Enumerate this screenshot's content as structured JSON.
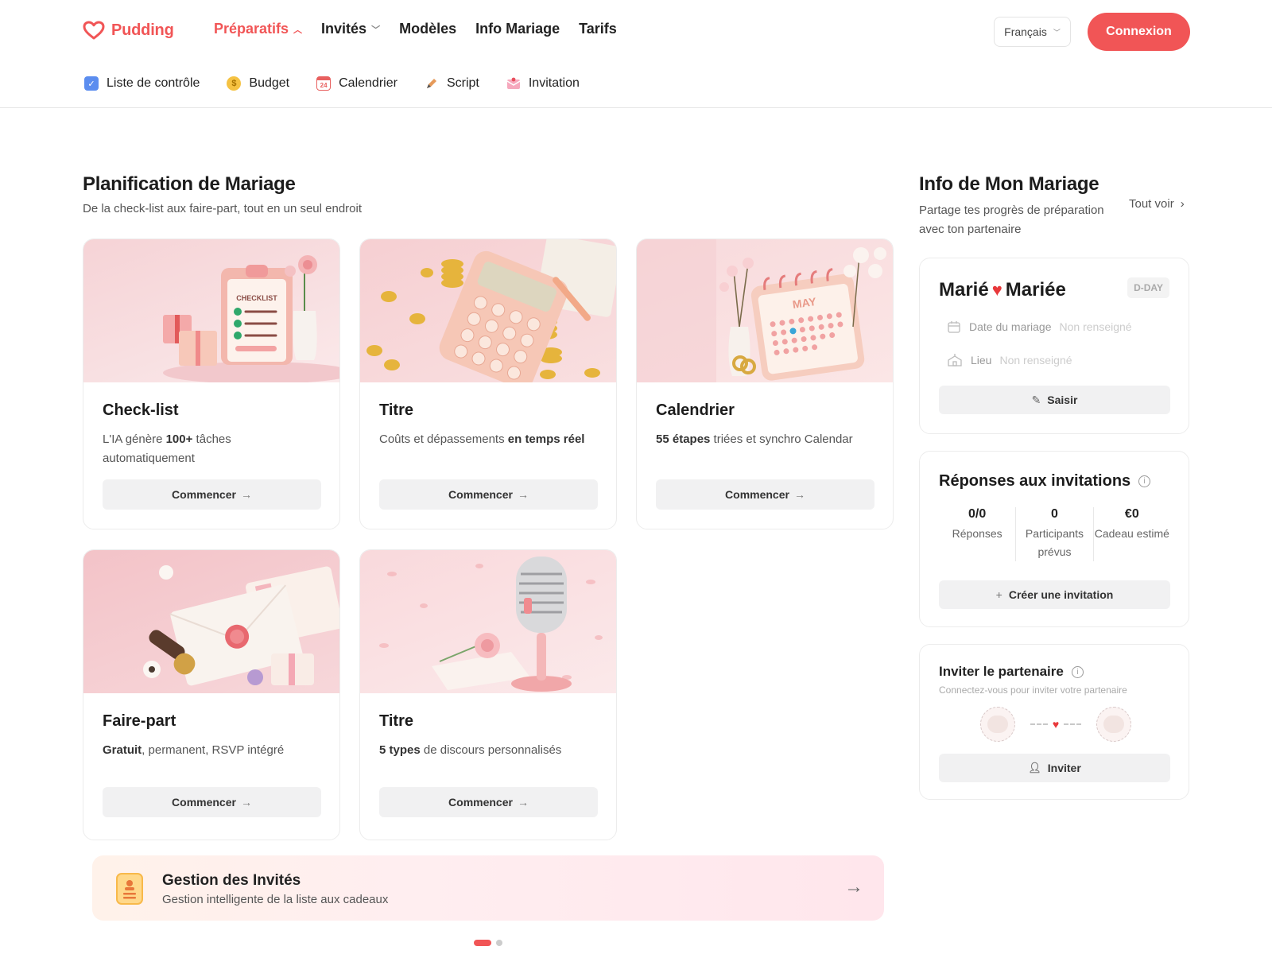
{
  "brand": {
    "name": "Pudding",
    "color": "#f15556"
  },
  "nav": {
    "items": [
      {
        "label": "Préparatifs",
        "active": true,
        "has_dropdown": true
      },
      {
        "label": "Invités",
        "active": false,
        "has_dropdown": true
      },
      {
        "label": "Modèles",
        "active": false,
        "has_dropdown": false
      },
      {
        "label": "Info Mariage",
        "active": false,
        "has_dropdown": false
      },
      {
        "label": "Tarifs",
        "active": false,
        "has_dropdown": false
      }
    ],
    "language": "Français",
    "login_label": "Connexion"
  },
  "subnav": {
    "items": [
      {
        "label": "Liste de contrôle",
        "icon": "checkbox-icon"
      },
      {
        "label": "Budget",
        "icon": "coin-icon"
      },
      {
        "label": "Calendrier",
        "icon": "calendar-icon"
      },
      {
        "label": "Script",
        "icon": "pen-icon"
      },
      {
        "label": "Invitation",
        "icon": "envelope-icon"
      }
    ]
  },
  "main": {
    "title": "Planification de Mariage",
    "subtitle": "De la check-list aux faire-part, tout en un seul endroit",
    "cards": [
      {
        "title": "Check-list",
        "desc_html": "L'IA génère <b>100+</b> tâches automatiquement",
        "button": "Commencer",
        "image": "checklist-illustration"
      },
      {
        "title": "Titre",
        "desc_html": "Coûts et dépassements <b>en temps réel</b>",
        "button": "Commencer",
        "image": "calculator-illustration"
      },
      {
        "title": "Calendrier",
        "desc_html": "<b>55 étapes</b> triées et synchro Calendar",
        "button": "Commencer",
        "image": "calendar-illustration",
        "calendar_month": "MAY"
      },
      {
        "title": "Faire-part",
        "desc_html": "<b>Gratuit</b>, permanent, RSVP intégré",
        "button": "Commencer",
        "image": "envelope-illustration"
      },
      {
        "title": "Titre",
        "desc_html": "<b>5 types</b> de discours personnalisés",
        "button": "Commencer",
        "image": "microphone-illustration"
      }
    ],
    "banner": {
      "title": "Gestion des Invités",
      "subtitle": "Gestion intelligente de la liste aux cadeaux"
    },
    "pagination": {
      "pages": 2,
      "current": 1
    }
  },
  "sidebar": {
    "title": "Info de Mon Mariage",
    "subtitle": "Partage tes progrès de préparation avec ton partenaire",
    "see_all": "Tout voir",
    "wedding": {
      "groom": "Marié",
      "bride": "Mariée",
      "badge": "D-DAY",
      "date_label": "Date du mariage",
      "date_value": "Non renseigné",
      "place_label": "Lieu",
      "place_value": "Non renseigné",
      "button": "Saisir"
    },
    "rsvp": {
      "title": "Réponses aux invitations",
      "stats": [
        {
          "value": "0/0",
          "label": "Réponses"
        },
        {
          "value": "0",
          "label": "Participants prévus"
        },
        {
          "value": "€0",
          "label": "Cadeau estimé"
        }
      ],
      "button": "Créer une invitation"
    },
    "partner": {
      "title": "Inviter le partenaire",
      "subtitle": "Connectez-vous pour inviter votre partenaire",
      "button": "Inviter"
    }
  }
}
